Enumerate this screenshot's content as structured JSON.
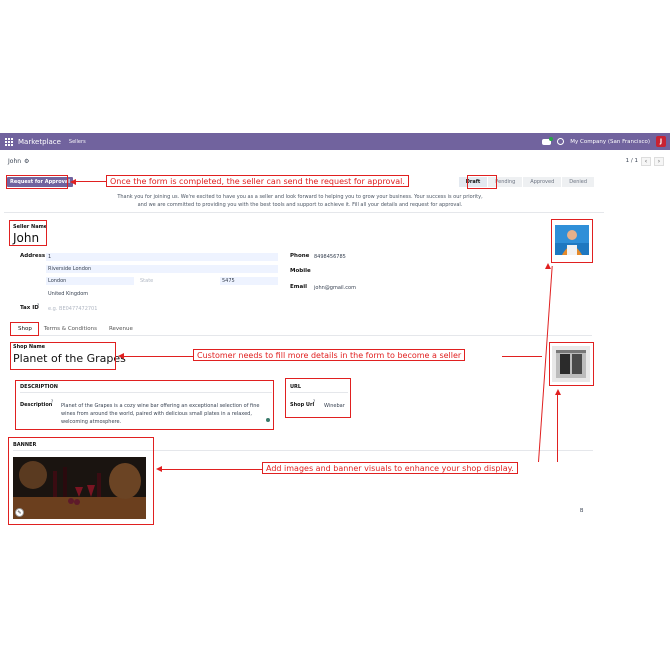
{
  "navbar": {
    "brand": "Marketplace",
    "menu": "Sellers",
    "company": "My Company (San Francisco)",
    "avatar_letter": "J"
  },
  "control": {
    "record_title": "John",
    "pager": "1 / 1"
  },
  "statusbar": {
    "request_label": "Request for Approval",
    "stages": [
      "Draft",
      "Pending",
      "Approved",
      "Denied"
    ],
    "active_stage": "Draft"
  },
  "welcome": {
    "line1": "Thank you for joining us. We're excited to have you as a seller and look forward to helping you to grow your business. Your success is our priority,",
    "line2": "and we are committed to providing you with the best tools and support to achieve it. Fill all your details and request for approval."
  },
  "seller": {
    "name_label": "Seller Name",
    "name": "John",
    "address_label": "Address",
    "street": "1",
    "street2": "Riverside London",
    "city": "London",
    "state_placeholder": "State",
    "zip": "5475",
    "country": "United Kingdom",
    "tax_label": "Tax ID",
    "tax_placeholder": "e.g. BE0477472701",
    "phone_label": "Phone",
    "phone": "8498456785",
    "mobile_label": "Mobile",
    "email_label": "Email",
    "email": "john@gmail.com"
  },
  "tabs": [
    "Shop",
    "Terms & Conditions",
    "Revenue"
  ],
  "shop": {
    "name_label": "Shop Name",
    "name": "Planet of the Grapes",
    "description_head": "DESCRIPTION",
    "description_label": "Description",
    "description": "Planet of the Grapes is a cozy wine bar offering an exceptional selection of fine wines from around the world, paired with delicious small plates in a relaxed, welcoming atmosphere.",
    "url_head": "URL",
    "shop_url_label": "Shop Url",
    "shop_url": "Winebar",
    "banner_head": "BANNER",
    "tag_b": "B"
  },
  "annotations": {
    "approval": "Once the form is completed, the seller can send the request for approval.",
    "details": "Customer needs to fill more details in the form to become a seller",
    "images": "Add images and banner visuals to enhance your shop display."
  },
  "colors": {
    "navbar": "#71639e",
    "annotation": "#e02020"
  }
}
